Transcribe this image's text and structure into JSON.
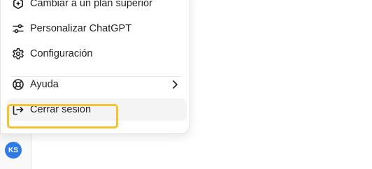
{
  "menu": {
    "items": [
      {
        "label": "Cambiar a un plan superior",
        "icon": "upgrade-plan-icon"
      },
      {
        "label": "Personalizar ChatGPT",
        "icon": "sliders-icon"
      },
      {
        "label": "Configuración",
        "icon": "gear-icon"
      },
      {
        "label": "Ayuda",
        "icon": "lifebuoy-icon"
      },
      {
        "label": "Cerrar sesión",
        "icon": "logout-icon"
      }
    ]
  },
  "user": {
    "initials": "KS",
    "avatar_color": "#2f7ae5"
  },
  "colors": {
    "highlight": "#f4c430",
    "text": "#1f1f1f"
  }
}
